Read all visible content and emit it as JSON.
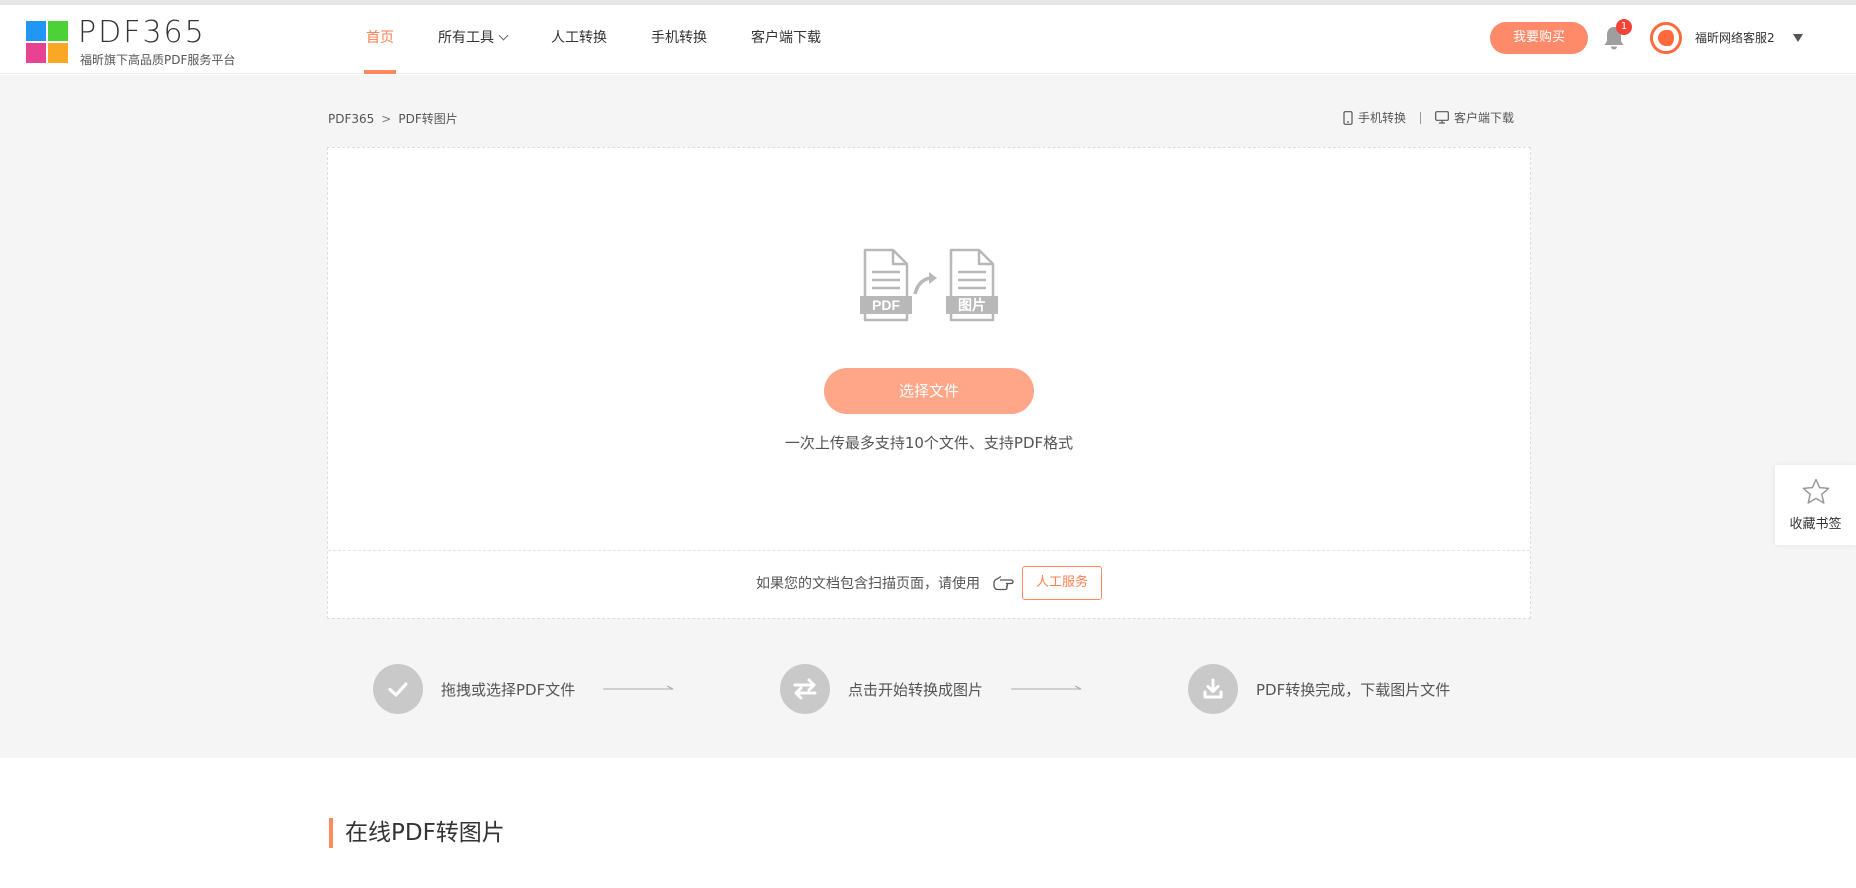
{
  "header": {
    "logo_name": "PDF365",
    "logo_subtitle": "福昕旗下高品质PDF服务平台",
    "nav": [
      {
        "label": "首页",
        "active": true
      },
      {
        "label": "所有工具",
        "has_dropdown": true
      },
      {
        "label": "人工转换"
      },
      {
        "label": "手机转换"
      },
      {
        "label": "客户端下载"
      }
    ],
    "buy_label": "我要购买",
    "notification_count": "1",
    "username": "福昕网络客服2",
    "accent_color": "#ff8a5c"
  },
  "breadcrumb": {
    "root": "PDF365",
    "separator": ">",
    "current": "PDF转图片"
  },
  "quick_links": {
    "mobile": "手机转换",
    "desktop": "客户端下载"
  },
  "upload": {
    "pdf_icon_label": "PDF",
    "image_icon_label": "图片",
    "select_button": "选择文件",
    "hint": "一次上传最多支持10个文件、支持PDF格式",
    "scan_text": "如果您的文档包含扫描页面，请使用",
    "human_service_button": "人工服务"
  },
  "steps": [
    {
      "icon": "check-icon",
      "label": "拖拽或选择PDF文件"
    },
    {
      "icon": "swap-icon",
      "label": "点击开始转换成图片"
    },
    {
      "icon": "download-icon",
      "label": "PDF转换完成，下载图片文件"
    }
  ],
  "section_title": "在线PDF转图片",
  "bookmark_label": "收藏书签"
}
